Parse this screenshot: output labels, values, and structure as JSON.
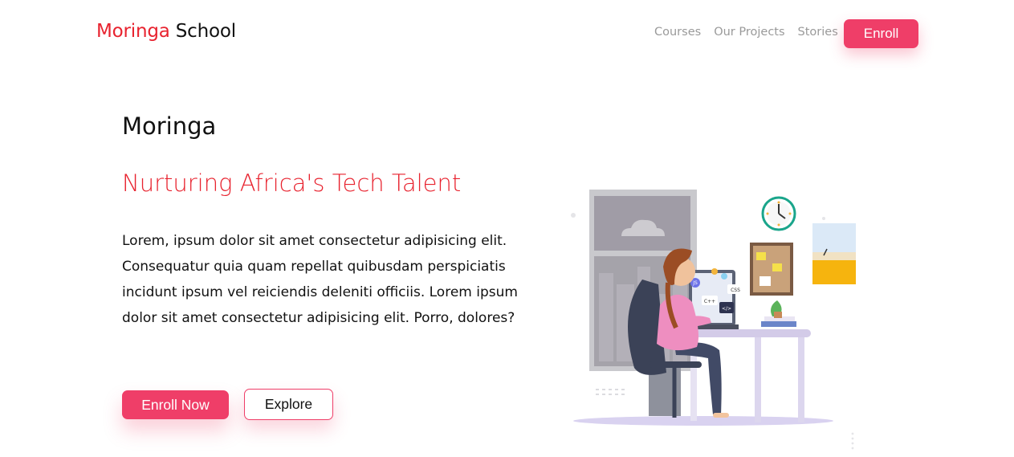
{
  "brand": {
    "accent_part": "Moringa",
    "rest_part": "School",
    "accent_color": "#e8232f"
  },
  "nav": {
    "links": [
      "Courses",
      "Our Projects",
      "Stories"
    ],
    "enroll_label": "Enroll",
    "button_color": "#ef3e68"
  },
  "hero": {
    "title": "Moringa",
    "subtitle": "Nurturing Africa's Tech Talent",
    "body": "Lorem, ipsum dolor sit amet consectetur adipisicing elit. Consequatur quia quam repellat quibusdam perspiciatis incidunt ipsum vel reiciendis deleniti officiis. Lorem ipsum dolor sit amet consectetur adipisicing elit. Porro, dolores?",
    "primary_button": "Enroll Now",
    "secondary_button": "Explore"
  },
  "illustration": {
    "icon": "woman-coding-at-desk-illustration",
    "badges": [
      "JS",
      "C++",
      "CSS",
      "</>"
    ]
  }
}
